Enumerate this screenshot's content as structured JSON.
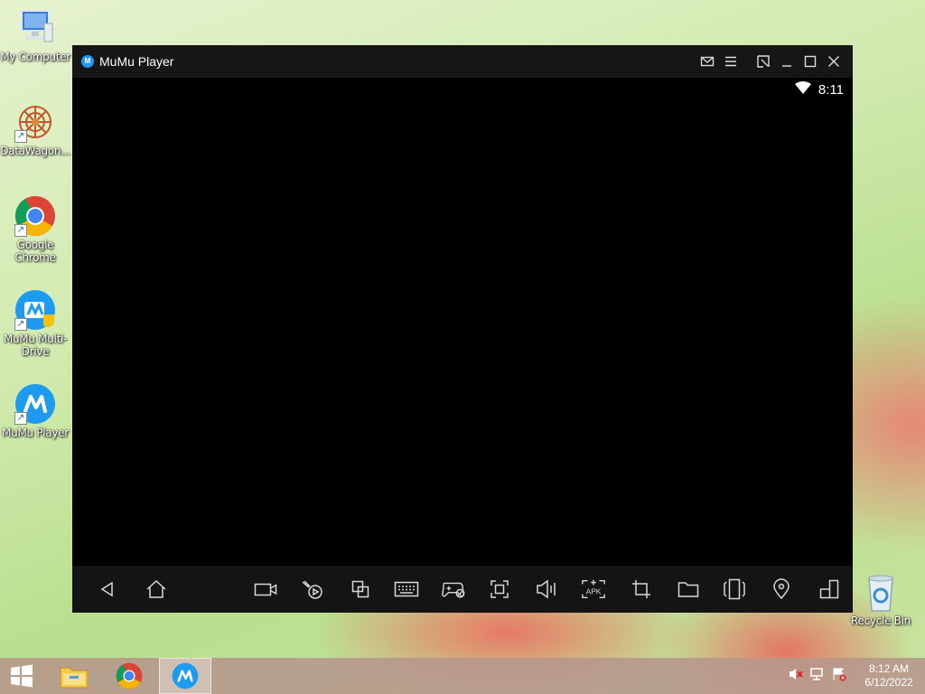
{
  "desktop": {
    "icons": [
      {
        "label": "My Computer",
        "icon": "computer-icon"
      },
      {
        "label": "DataWagon...",
        "icon": "datawagon-icon"
      },
      {
        "label": "Google Chrome",
        "icon": "chrome-icon"
      },
      {
        "label": "MuMu Multi-Drive",
        "icon": "mumu-multidrive-icon"
      },
      {
        "label": "MuMu Player",
        "icon": "mumu-player-icon"
      },
      {
        "label": "Recycle Bin",
        "icon": "recycle-bin-icon"
      }
    ]
  },
  "window": {
    "title": "MuMu Player",
    "status_time": "8:11",
    "titlebar_buttons": [
      "mail-icon",
      "menu-icon",
      "pin-icon",
      "minimize-icon",
      "maximize-icon",
      "close-icon"
    ],
    "toolbar": [
      "back-icon",
      "home-icon",
      "record-icon",
      "macro-icon",
      "multi-window-icon",
      "keyboard-icon",
      "gamepad-icon",
      "fullscreen-icon",
      "volume-icon",
      "apk-install-icon",
      "crop-icon",
      "folder-icon",
      "shake-icon",
      "location-icon",
      "rotate-icon"
    ],
    "apk_label": "APK"
  },
  "taskbar": {
    "time": "8:12 AM",
    "date": "6/12/2022",
    "items": [
      "windows-start-icon",
      "file-explorer-icon",
      "chrome-icon",
      "mumu-player-icon"
    ],
    "tray": [
      "volume-muted-icon",
      "network-icon",
      "action-center-icon"
    ]
  },
  "colors": {
    "accent": "#1e9bf0",
    "titlebar": "#161616",
    "toolbar": "#141414"
  }
}
